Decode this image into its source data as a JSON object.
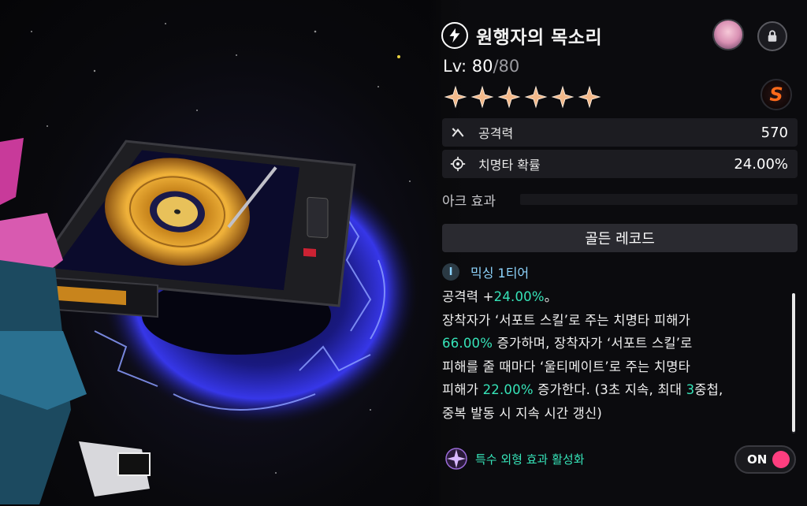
{
  "item": {
    "title": "원행자의 목소리",
    "level_label": "Lv:",
    "level_current": "80",
    "level_max": "/80",
    "stars": 6,
    "rank_letter": "S",
    "icons": {
      "element": "lightning-icon",
      "avatar": "character-avatar",
      "lock": "lock-icon"
    }
  },
  "stats": [
    {
      "icon": "attack-icon",
      "label": "공격력",
      "value": "570"
    },
    {
      "icon": "crit-rate-icon",
      "label": "치명타 확률",
      "value": "24.00%"
    }
  ],
  "arc": {
    "section_label": "아크 효과",
    "effect_name": "골든 레코드",
    "tier_badge": "I",
    "tier_text": "믹싱 1티어",
    "desc": {
      "l1a": "공격력 +",
      "l1hl": "24.00%",
      "l1b": "。",
      "l2": "장착자가 ‘서포트 스킬’로 주는 치명타 피해가",
      "l3hl": "66.00%",
      "l3b": " 증가하며, 장착자가 ‘서포트 스킬’로",
      "l4": "피해를 줄 때마다 ‘울티메이트’로 주는 치명타",
      "l5a": "피해가 ",
      "l5hl": "22.00%",
      "l5b": " 증가한다. (3초 지속, 최대 ",
      "l5hl2": "3",
      "l5c": "중첩,",
      "l6": "중복 발동 시 지속 시간 갱신)"
    }
  },
  "special": {
    "label": "특수 외형 효과 활성화",
    "toggle_label": "ON",
    "toggle_state": true
  },
  "colors": {
    "highlight": "#36e3b8",
    "tier": "#8fd6ff",
    "toggle_knob": "#ff3e7f",
    "star": "#f3b98a",
    "rank": "#ff6a1a"
  }
}
